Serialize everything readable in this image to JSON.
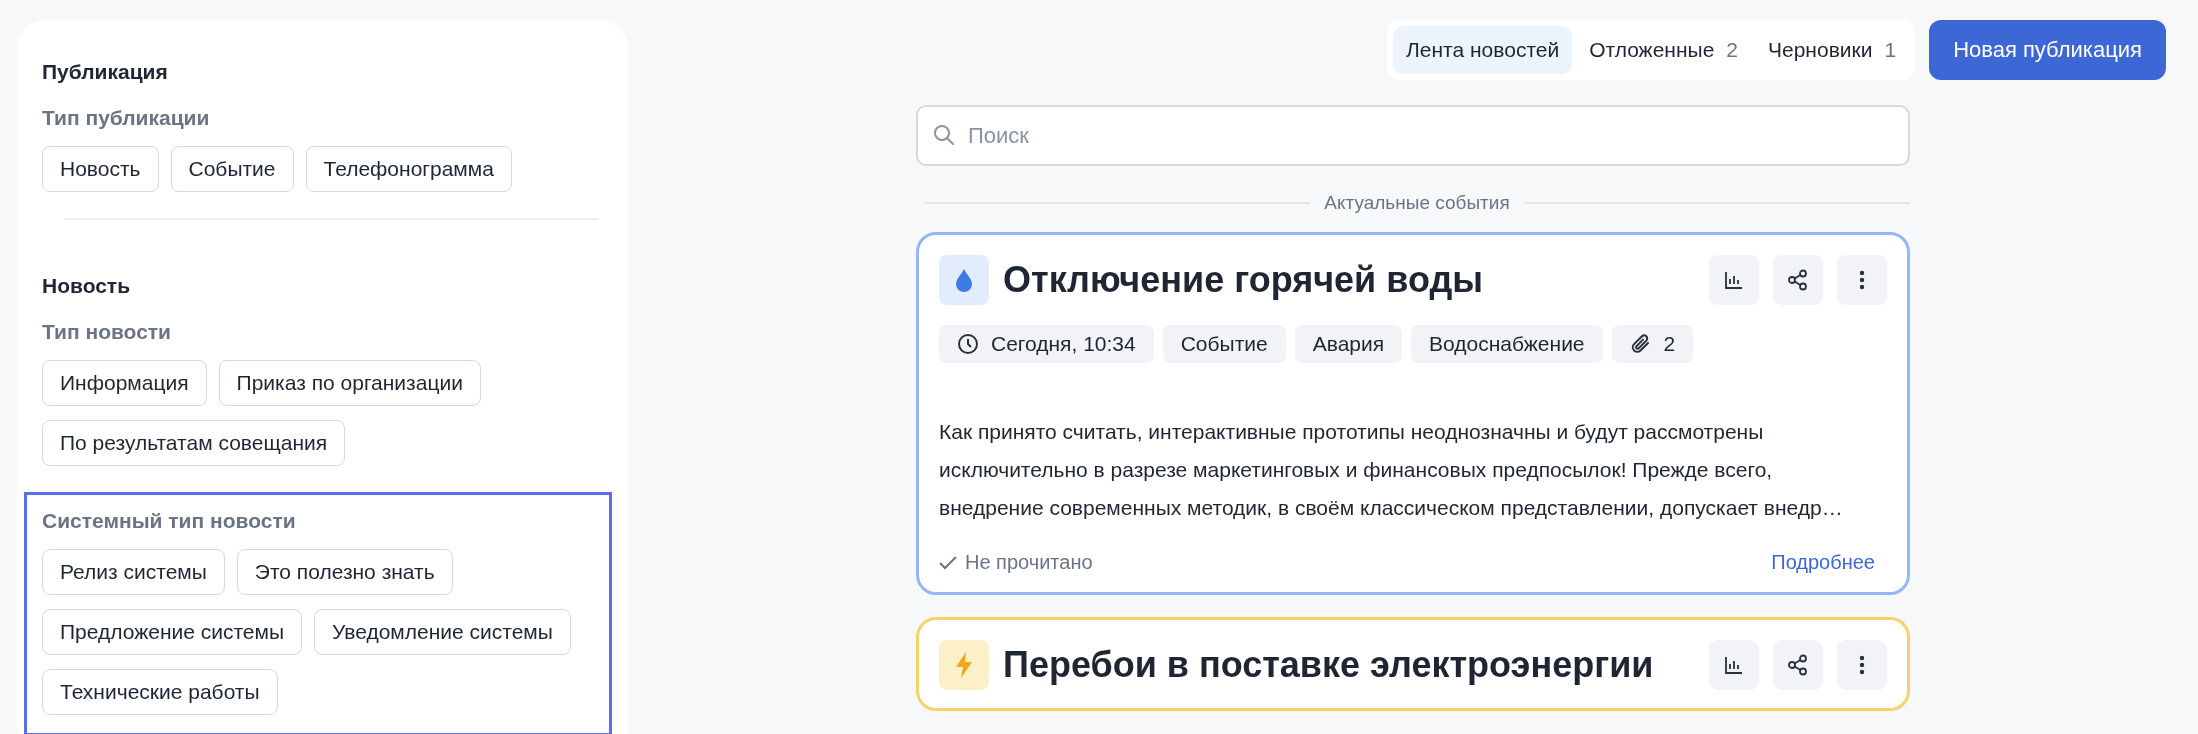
{
  "filters": {
    "sections": [
      {
        "title": "Публикация",
        "groups": [
          {
            "label": "Тип публикации",
            "highlighted": false,
            "chips": [
              "Новость",
              "Событие",
              "Телефонограмма"
            ]
          }
        ]
      },
      {
        "title": "Новость",
        "groups": [
          {
            "label": "Тип новости",
            "highlighted": false,
            "chips": [
              "Информация",
              "Приказ по организации",
              "По результатам совещания"
            ]
          },
          {
            "label": "Системный тип новости",
            "highlighted": true,
            "chips": [
              "Релиз системы",
              "Это полезно знать",
              "Предложение системы",
              "Уведомление системы",
              "Технические работы"
            ]
          }
        ]
      }
    ]
  },
  "tabs": [
    {
      "label": "Лента новостей",
      "selected": true
    },
    {
      "label": "Отложенные",
      "count": "2",
      "selected": false
    },
    {
      "label": "Черновики",
      "count": "1",
      "selected": false
    }
  ],
  "new_button": "Новая публикация",
  "search": {
    "placeholder": "Поиск"
  },
  "divider_label": "Актуальные события",
  "cards": [
    {
      "kind": "water",
      "color": "#93b8f5",
      "title": "Отключение горячей воды",
      "time": "Сегодня, 10:34",
      "tags": [
        "Событие",
        "Авария",
        "Водоснабжение"
      ],
      "attachments": "2",
      "text": "Как принято считать, интерактивные прототипы неоднозначны и будут рассмотрены исключительно в разрезе маркетинговых и финансовых предпосылок! Прежде всего, внедрение современных методик, в своём классическом представлении, допускает внедр…",
      "status": "Не прочитано",
      "more": "Подробнее"
    },
    {
      "kind": "power",
      "color": "#f5d26b",
      "title": "Перебои в поставке электроэнергии"
    }
  ]
}
